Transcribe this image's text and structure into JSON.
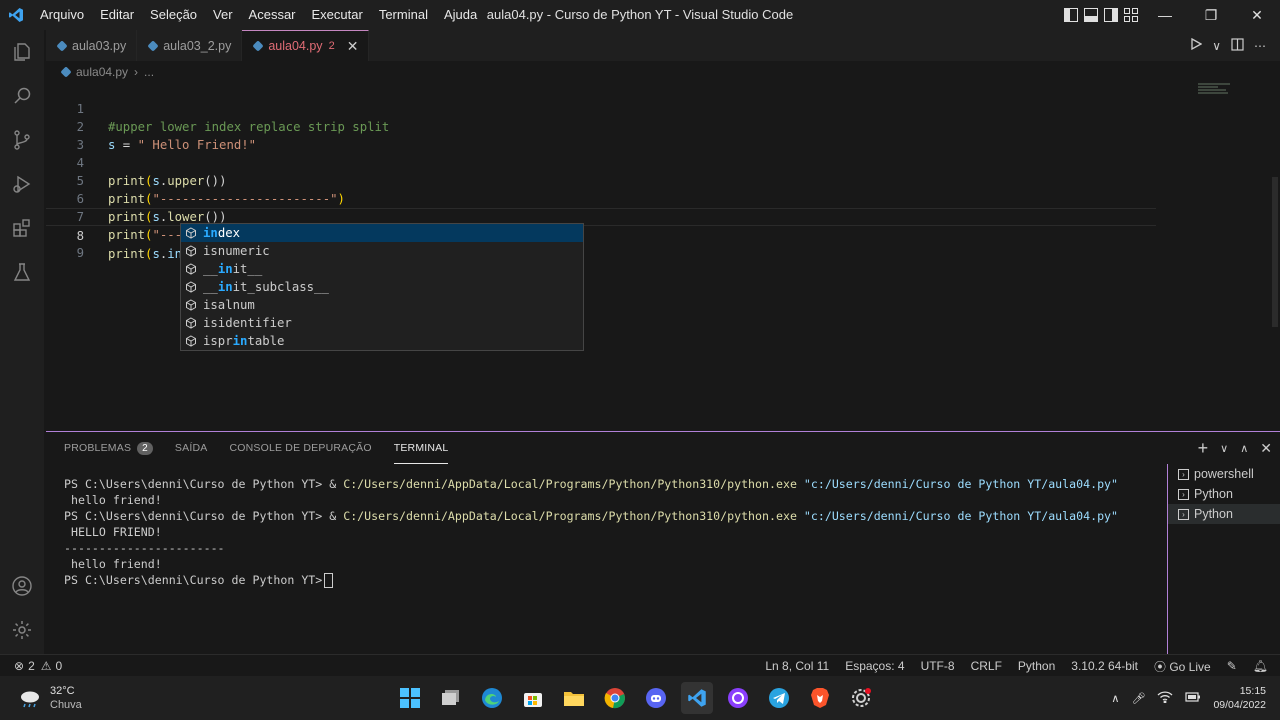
{
  "window": {
    "title": "aula04.py - Curso de Python YT - Visual Studio Code",
    "menu": [
      "Arquivo",
      "Editar",
      "Seleção",
      "Ver",
      "Acessar",
      "Executar",
      "Terminal",
      "Ajuda"
    ]
  },
  "tabs": [
    {
      "label": "aula03.py"
    },
    {
      "label": "aula03_2.py"
    },
    {
      "label": "aula04.py",
      "badge": "2",
      "active": true
    }
  ],
  "breadcrumb": {
    "file": "aula04.py",
    "rest": "..."
  },
  "editor": {
    "lines": [
      {
        "n": "1",
        "text": "#upper lower index replace strip split"
      },
      {
        "n": "2",
        "text": "s = \" Hello Friend!\""
      },
      {
        "n": "3",
        "text": ""
      },
      {
        "n": "4",
        "text": "print(s.upper())"
      },
      {
        "n": "5",
        "text": "print(\"-----------------------\")"
      },
      {
        "n": "6",
        "text": "print(s.lower())"
      },
      {
        "n": "7",
        "text": "print(\"-----------------------\")"
      },
      {
        "n": "8",
        "text": "print(s.in)"
      },
      {
        "n": "9",
        "text": ""
      }
    ],
    "current_line": "8"
  },
  "suggestions": {
    "items": [
      "index",
      "isnumeric",
      "__init__",
      "__init_subclass__",
      "isalnum",
      "isidentifier",
      "isprintable"
    ],
    "selected_index": 0,
    "icon": "method-cube-icon"
  },
  "panel": {
    "tabs": [
      {
        "label": "PROBLEMAS",
        "badge": "2"
      },
      {
        "label": "SAÍDA"
      },
      {
        "label": "CONSOLE DE DEPURAÇÃO"
      },
      {
        "label": "TERMINAL",
        "active": true
      }
    ],
    "terminal": {
      "prompt": "PS C:\\Users\\denni\\Curso de Python YT>",
      "exe": "C:/Users/denni/AppData/Local/Programs/Python/Python310/python.exe",
      "arg": "\"c:/Users/denni/Curso de Python YT/aula04.py\"",
      "out1": " hello friend!",
      "out2": " HELLO FRIEND!",
      "out3": "-----------------------",
      "out4": " hello friend!"
    },
    "terminal_list": [
      "powershell",
      "Python",
      "Python"
    ]
  },
  "statusbar": {
    "errors": "2",
    "warnings": "0",
    "position": "Ln 8, Col 11",
    "spaces": "Espaços: 4",
    "encoding": "UTF-8",
    "eol": "CRLF",
    "language": "Python",
    "interpreter": "3.10.2 64-bit",
    "golive": "Go Live"
  },
  "taskbar": {
    "temp": "32°C",
    "weather": "Chuva",
    "time": "15:15",
    "date": "09/04/2022"
  },
  "colors": {
    "accent": "#b180d7",
    "error_tab": "#e06c75",
    "selection": "#04395e",
    "match": "#2aaaff"
  }
}
